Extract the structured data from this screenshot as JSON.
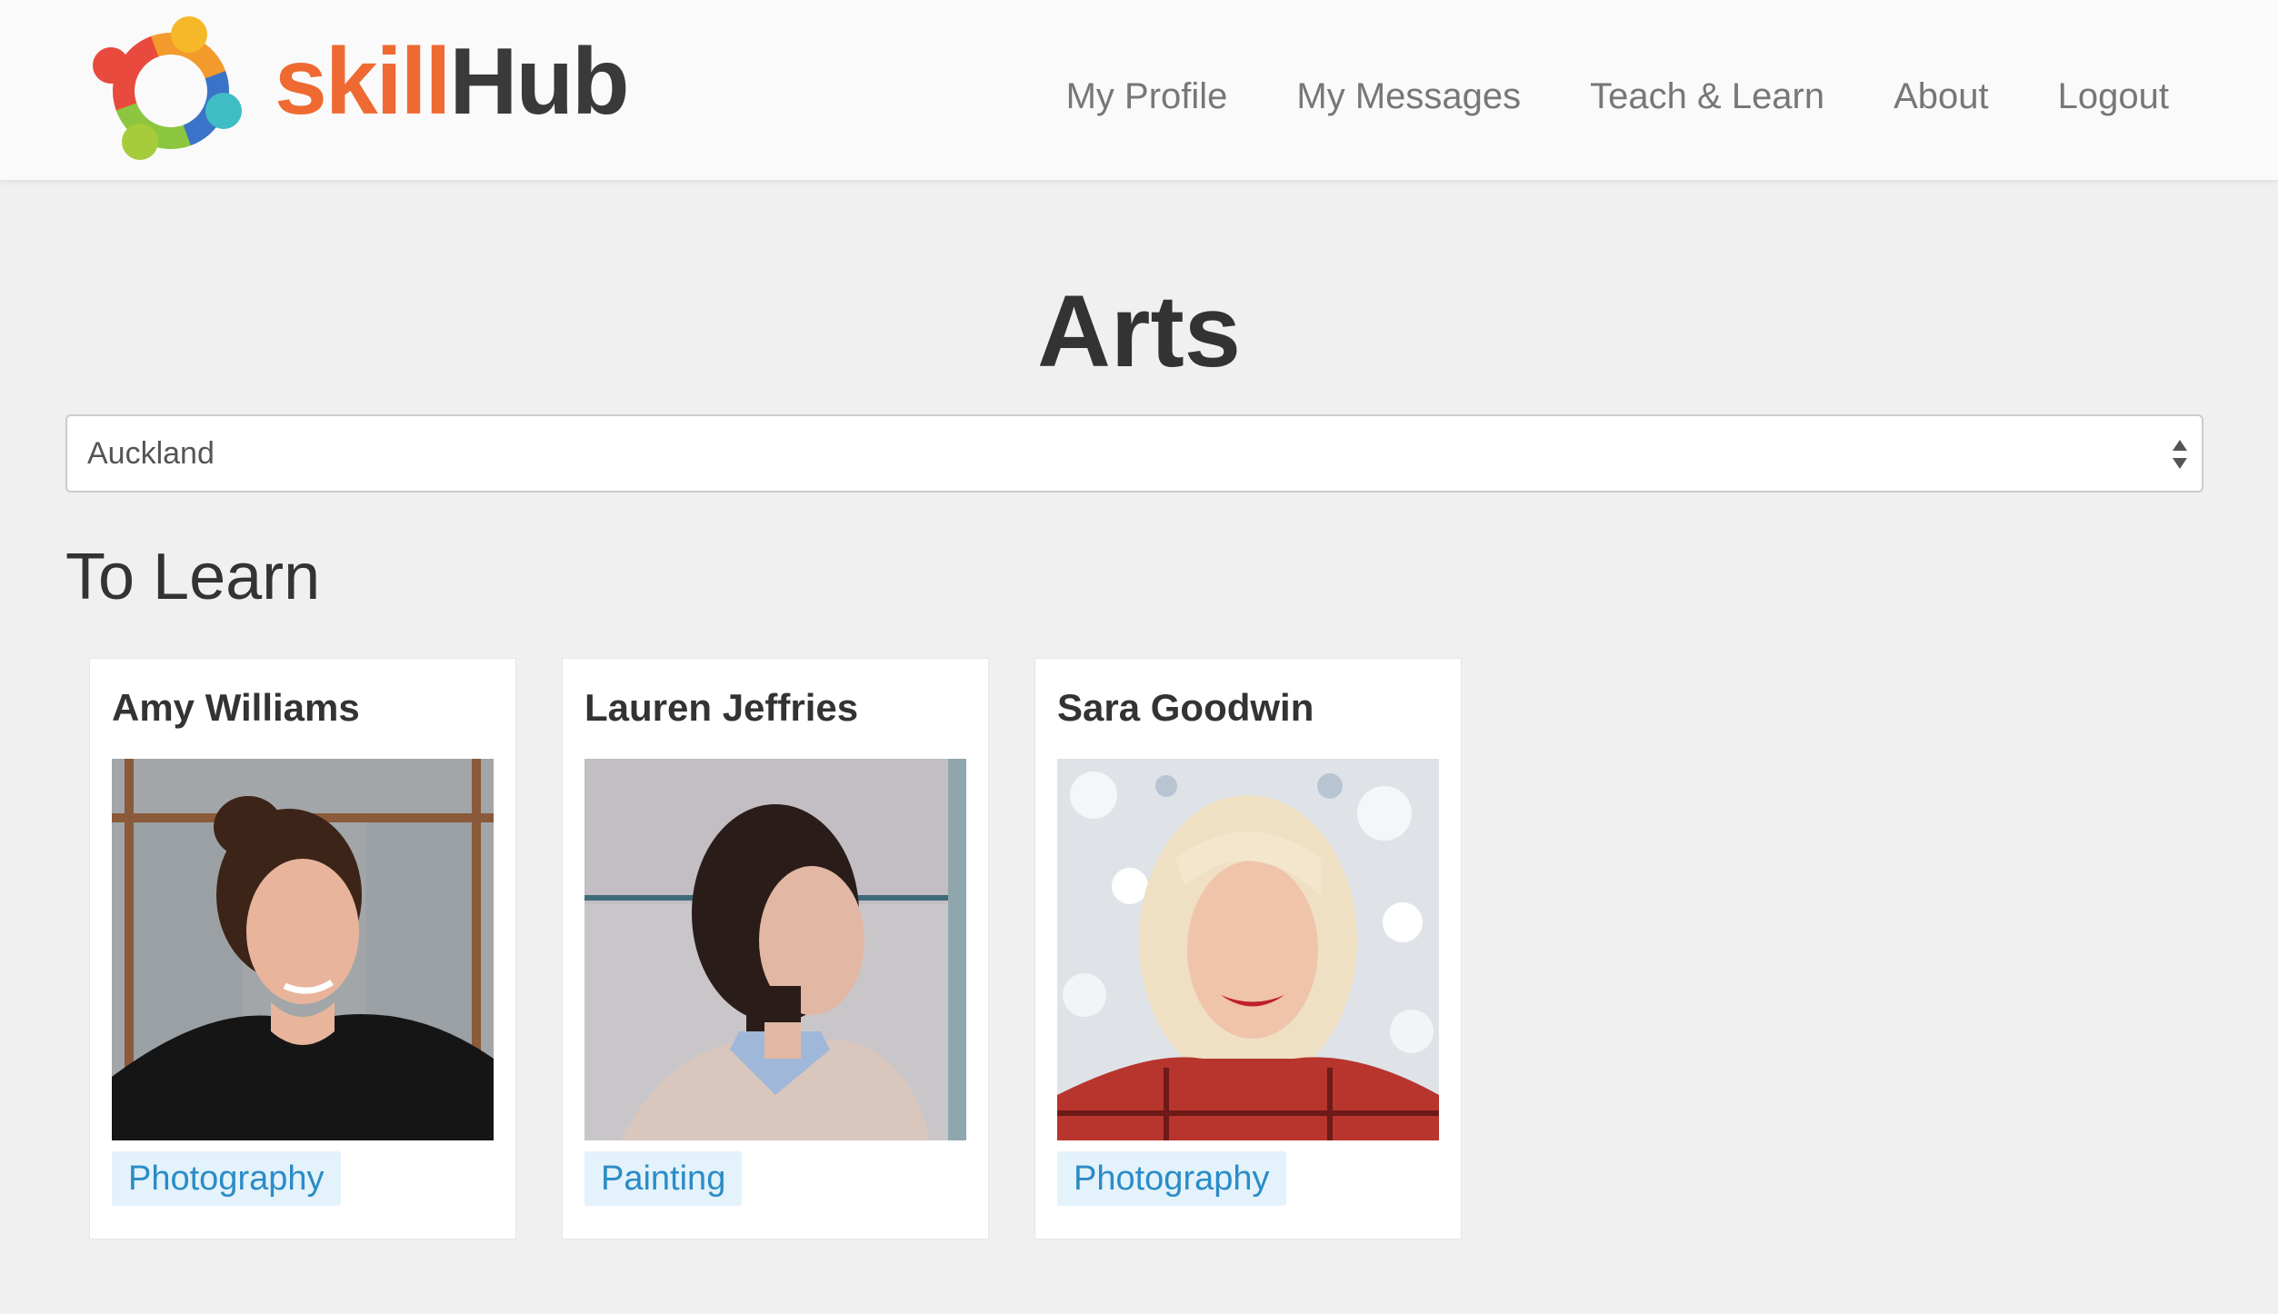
{
  "brand": {
    "name_part1": "skill",
    "name_part2": "Hub"
  },
  "nav": {
    "items": [
      {
        "label": "My Profile"
      },
      {
        "label": "My Messages"
      },
      {
        "label": "Teach & Learn"
      },
      {
        "label": "About"
      },
      {
        "label": "Logout"
      }
    ]
  },
  "page": {
    "title": "Arts"
  },
  "location_select": {
    "value": "Auckland"
  },
  "section": {
    "title": "To Learn"
  },
  "cards": [
    {
      "name": "Amy Williams",
      "skill": "Photography",
      "photo_icon": "portrait-photo"
    },
    {
      "name": "Lauren Jeffries",
      "skill": "Painting",
      "photo_icon": "portrait-photo"
    },
    {
      "name": "Sara Goodwin",
      "skill": "Photography",
      "photo_icon": "portrait-photo"
    }
  ],
  "colors": {
    "brand_orange": "#ef6a32",
    "brand_dark": "#3a3a3a",
    "tag_bg": "#e3f2fb",
    "tag_text": "#2a8cc6",
    "page_bg": "#f0f0f0"
  }
}
